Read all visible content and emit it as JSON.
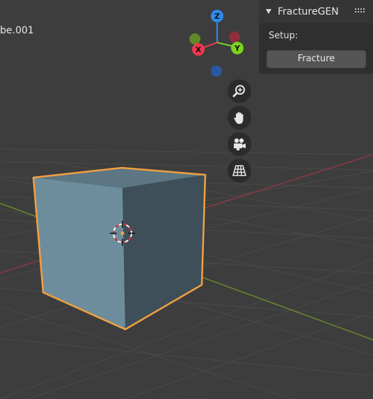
{
  "viewport": {
    "object_label": "be.001"
  },
  "gizmo": {
    "z_label": "Z",
    "x_label": "X",
    "y_label": "Y",
    "colors": {
      "x": "#f0374f",
      "y": "#7bd21f",
      "z": "#2e8af0"
    }
  },
  "nav_buttons": [
    "zoom-icon",
    "hand-pan-icon",
    "camera-icon",
    "grid-perspective-icon"
  ],
  "panel": {
    "title": "FractureGEN",
    "setup_label": "Setup:",
    "fracture_button": "Fracture"
  },
  "colors": {
    "background": "#3d3d3d",
    "selection_outline": "#f3a140",
    "cube_front": "#6e8d9c",
    "cube_side": "#3e4f5a",
    "cube_top": "#5c7683"
  }
}
